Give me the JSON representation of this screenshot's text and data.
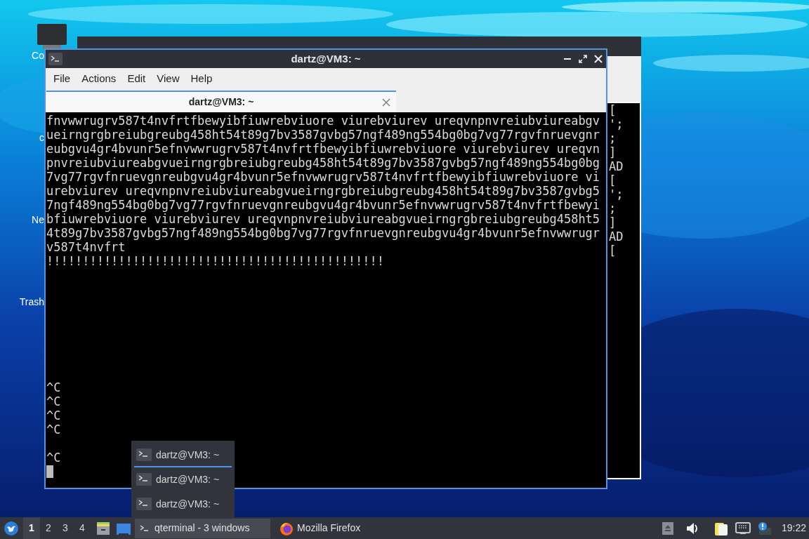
{
  "desktop": {
    "icons": [
      {
        "label": "Co",
        "kind": "computer"
      },
      {
        "label": "c",
        "kind": "folder"
      },
      {
        "label": "Ne",
        "kind": "network"
      },
      {
        "label": "Trash",
        "kind": "trash"
      }
    ]
  },
  "back_window": {
    "terminal_lines": [
      "[",
      "';",
      ";",
      "]",
      "AD",
      "[",
      "';",
      ";",
      "]",
      "AD",
      "["
    ]
  },
  "window": {
    "title": "dartz@VM3: ~",
    "menu": [
      "File",
      "Actions",
      "Edit",
      "View",
      "Help"
    ],
    "tabs": [
      {
        "label": "dartz@VM3: ~",
        "selected": true
      }
    ],
    "terminal": {
      "cursor": true,
      "lines": [
        {
          "kind": "text",
          "text": "fnvwwrugrv587t4nvfrtfbewyibfiuwrebviuore viurebviurev ureqvnpnvreiubviureabgv"
        },
        {
          "kind": "text",
          "text": "ueirngrgbreiubgreubg458ht54t89g7bv3587gvbg57ngf489ng554bg0bg7vg77rgvfnruevgnr"
        },
        {
          "kind": "text",
          "text": "eubgvu4gr4bvunr5efnvwwrugrv587t4nvfrtfbewyibfiuwrebviuore viurebviurev ureqvn"
        },
        {
          "kind": "text",
          "text": "pnvreiubviureabgvueirngrgbreiubgreubg458ht54t89g7bv3587gvbg57ngf489ng554bg0bg"
        },
        {
          "kind": "text",
          "text": "7vg77rgvfnruevgnreubgvu4gr4bvunr5efnvwwrugrv587t4nvfrtfbewyibfiuwrebviuore vi"
        },
        {
          "kind": "text",
          "text": "urebviurev ureqvnpnvreiubviureabgvueirngrgbreiubgreubg458ht54t89g7bv3587gvbg5"
        },
        {
          "kind": "text",
          "text": "7ngf489ng554bg0bg7vg77rgvfnruevgnreubgvu4gr4bvunr5efnvwwrugrv587t4nvfrtfbewyi"
        },
        {
          "kind": "text",
          "text": "bfiuwrebviuore viurebviurev ureqvnpnvreiubviureabgvueirngrgbreiubgreubg458ht5"
        },
        {
          "kind": "text",
          "text": "4t89g7bv3587gvbg57ngf489ng554bg0bg7vg77rgvfnruevgnreubgvu4gr4bvunr5efnvwwrugr"
        },
        {
          "kind": "text",
          "text": "v587t4nvfrt"
        },
        {
          "kind": "text",
          "text": "!!!!!!!!!!!!!!!!!!!!!!!!!!!!!!!!!!!!!!!!!!!!!!!"
        },
        {
          "kind": "blank"
        },
        {
          "kind": "blank"
        },
        {
          "kind": "blank"
        },
        {
          "kind": "blank"
        },
        {
          "kind": "blank"
        },
        {
          "kind": "blank"
        },
        {
          "kind": "blank"
        },
        {
          "kind": "blank"
        },
        {
          "kind": "text",
          "text": "^C"
        },
        {
          "kind": "text",
          "text": "^C"
        },
        {
          "kind": "text",
          "text": "^C"
        },
        {
          "kind": "text",
          "text": "^C"
        },
        {
          "kind": "blank"
        },
        {
          "kind": "text",
          "text": "^C"
        }
      ]
    }
  },
  "window_list_popup": {
    "items": [
      {
        "label": "dartz@VM3: ~",
        "selected": true
      },
      {
        "label": "dartz@VM3: ~",
        "selected": false
      },
      {
        "label": "dartz@VM3: ~",
        "selected": false
      }
    ]
  },
  "taskbar": {
    "workspaces": [
      {
        "label": "1",
        "selected": true
      },
      {
        "label": "2",
        "selected": false
      },
      {
        "label": "3",
        "selected": false
      },
      {
        "label": "4",
        "selected": false
      }
    ],
    "tasks": [
      {
        "label": "qterminal - 3 windows",
        "kind": "terminal",
        "selected": true
      },
      {
        "label": "Mozilla Firefox",
        "kind": "browser",
        "selected": false
      }
    ],
    "clock": "19:22"
  }
}
